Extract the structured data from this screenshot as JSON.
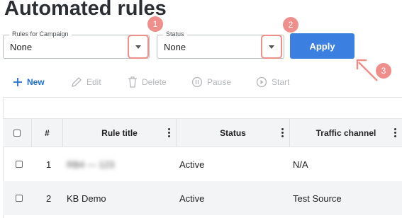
{
  "page": {
    "title": "Automated rules"
  },
  "filters": {
    "campaign": {
      "label": "Rules for Campaign",
      "value": "None"
    },
    "status": {
      "label": "Status",
      "value": "None"
    },
    "apply_label": "Apply"
  },
  "annotations": [
    "1",
    "2",
    "3"
  ],
  "toolbar": {
    "new_label": "New",
    "edit_label": "Edit",
    "delete_label": "Delete",
    "pause_label": "Pause",
    "start_label": "Start"
  },
  "table": {
    "headers": {
      "num": "#",
      "rule_title": "Rule title",
      "status": "Status",
      "traffic_channel": "Traffic channel"
    },
    "rows": [
      {
        "num": "1",
        "rule_title": "RB4 — 123",
        "status": "Active",
        "traffic_channel": "N/A"
      },
      {
        "num": "2",
        "rule_title": "KB Demo",
        "status": "Active",
        "traffic_channel": "Test Source"
      }
    ]
  },
  "colors": {
    "accent": "#3b7fe0",
    "annotation": "#ee8f8b",
    "header_bg": "#f3f4f6"
  }
}
